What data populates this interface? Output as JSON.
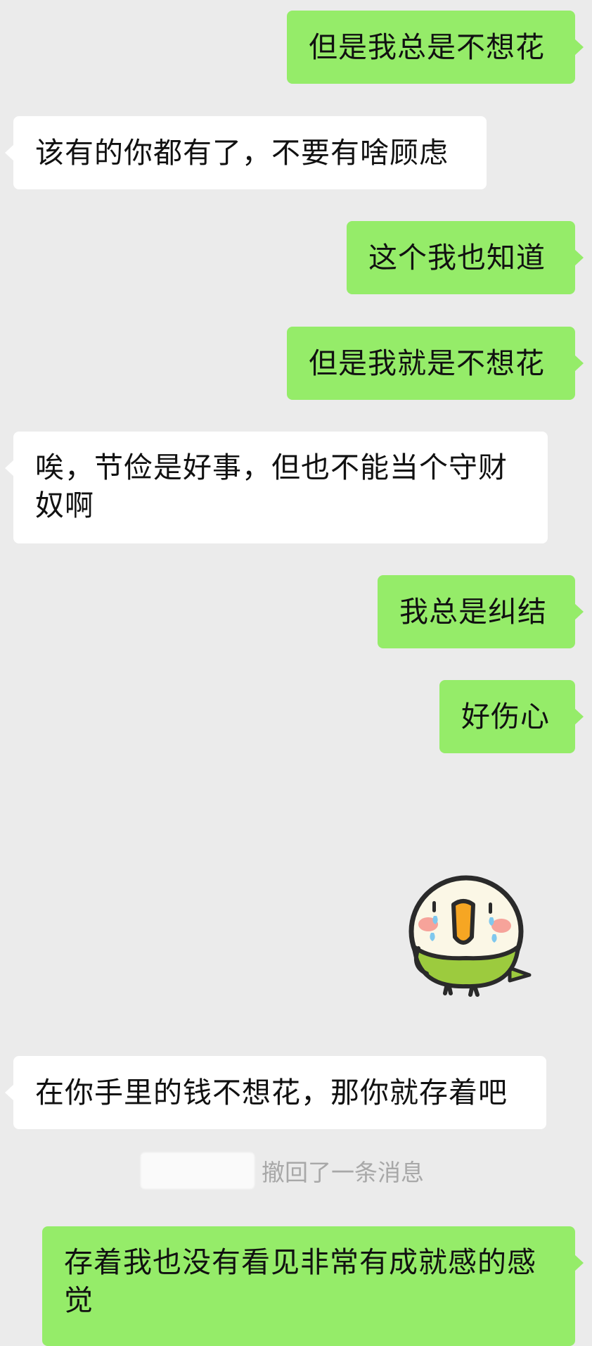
{
  "colors": {
    "background": "#ebebeb",
    "sent_bubble": "#95ec69",
    "received_bubble": "#ffffff",
    "system_text": "#a8a8a8"
  },
  "messages": [
    {
      "side": "sent",
      "text": "但是我总是不想花"
    },
    {
      "side": "received",
      "text": "该有的你都有了，不要有啥顾虑"
    },
    {
      "side": "sent",
      "text": "这个我也知道"
    },
    {
      "side": "sent",
      "text": "但是我就是不想花"
    },
    {
      "side": "received",
      "line1": "唉，节俭是好事，但也不能当个守财",
      "line2": "奴啊"
    },
    {
      "side": "sent",
      "text": "我总是纠结"
    },
    {
      "side": "sent",
      "text": "好伤心"
    },
    {
      "side": "sent",
      "sticker": "crying-parrot-sticker"
    },
    {
      "side": "received",
      "text": "在你手里的钱不想花，那你就存着吧"
    },
    {
      "side": "sent",
      "line1": "存着我也没有看见非常有成就感的感",
      "line2": "觉"
    }
  ],
  "system": {
    "recall_text": "撤回了一条消息"
  }
}
